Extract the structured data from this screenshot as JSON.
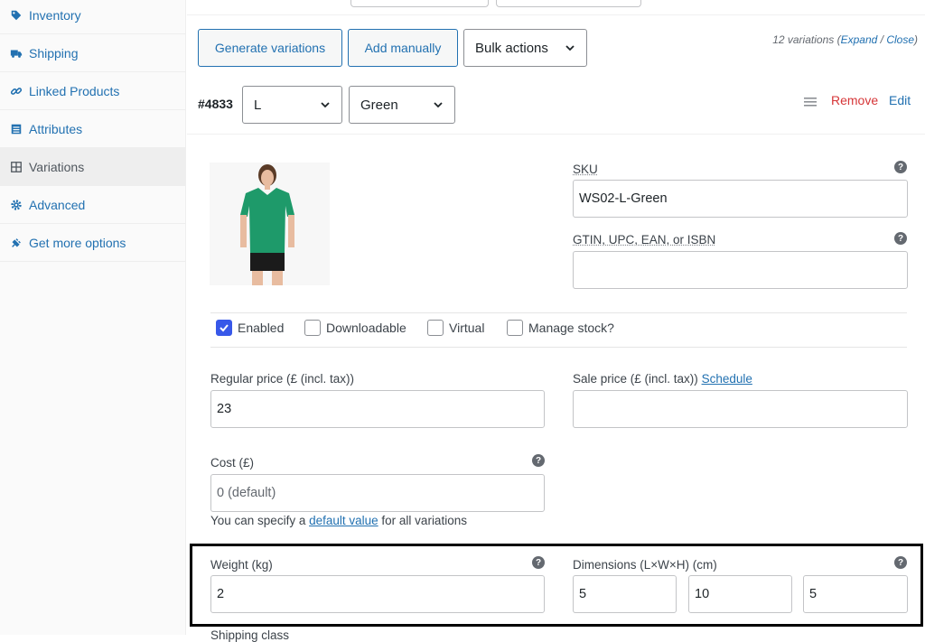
{
  "sidebar": {
    "items": [
      {
        "label": "Inventory",
        "icon": "tag-icon"
      },
      {
        "label": "Shipping",
        "icon": "truck-icon"
      },
      {
        "label": "Linked Products",
        "icon": "link-icon"
      },
      {
        "label": "Attributes",
        "icon": "list-icon"
      },
      {
        "label": "Variations",
        "icon": "grid-icon",
        "active": true
      },
      {
        "label": "Advanced",
        "icon": "gear-icon"
      },
      {
        "label": "Get more options",
        "icon": "plugin-icon"
      }
    ]
  },
  "toolbar": {
    "generate_label": "Generate variations",
    "add_manually_label": "Add manually",
    "bulk_actions_label": "Bulk actions",
    "count_text": "12 variations",
    "expand_label": "Expand",
    "close_label": "Close"
  },
  "variation": {
    "id": "#4833",
    "size": "L",
    "color": "Green",
    "remove_label": "Remove",
    "edit_label": "Edit",
    "sku_label": "SKU",
    "sku_value": "WS02-L-Green",
    "gtin_label": "GTIN, UPC, EAN, or ISBN",
    "gtin_value": "",
    "enabled_label": "Enabled",
    "downloadable_label": "Downloadable",
    "virtual_label": "Virtual",
    "manage_stock_label": "Manage stock?",
    "regular_price_label": "Regular price (£ (incl. tax))",
    "regular_price_value": "23",
    "sale_price_label": "Sale price (£ (incl. tax))",
    "schedule_label": "Schedule",
    "sale_price_value": "",
    "cost_label": "Cost (£)",
    "cost_placeholder": "0 (default)",
    "cost_hint_before": "You can specify a",
    "cost_hint_link": "default value",
    "cost_hint_after": "for all variations",
    "weight_label": "Weight (kg)",
    "weight_value": "2",
    "dimensions_label": "Dimensions (L×W×H) (cm)",
    "length_value": "5",
    "width_value": "10",
    "height_value": "5",
    "shipping_class_label": "Shipping class"
  },
  "colors": {
    "accent": "#2271b1",
    "danger": "#d63638",
    "checkbox": "#3858e9",
    "shirt": "#1e9a6a"
  }
}
